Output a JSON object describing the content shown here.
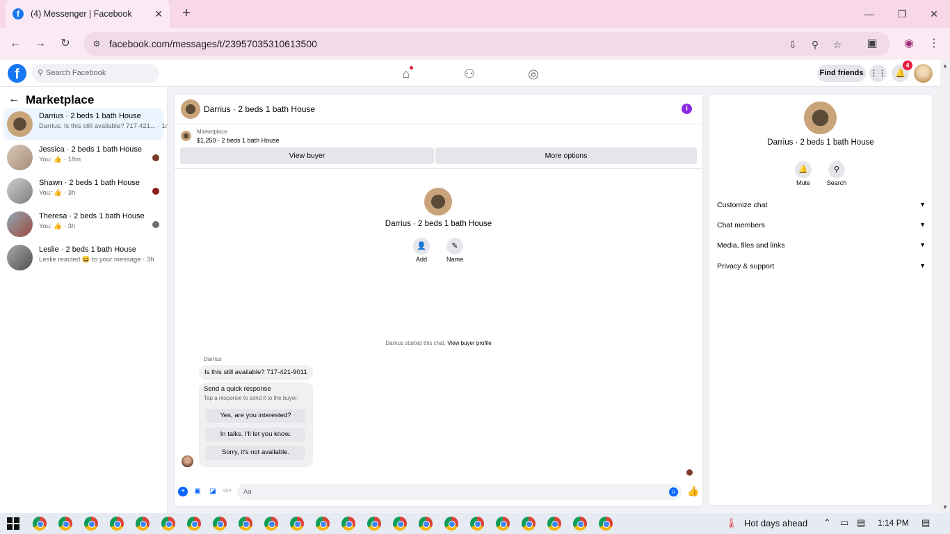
{
  "browser": {
    "tab_title": "(4) Messenger | Facebook",
    "tab_close": "✕",
    "new_tab": "+",
    "url": "facebook.com/messages/t/23957035310613500"
  },
  "fb": {
    "logo": "f",
    "search_placeholder": "Search Facebook",
    "find_friends": "Find friends",
    "notif_count": "4"
  },
  "left": {
    "title": "Marketplace",
    "conversations": [
      {
        "name": "Darrius · 2 beds 1 bath House",
        "preview": "Darrius: Is this still available? 717-421... · 1m",
        "active": true
      },
      {
        "name": "Jessica · 2 beds 1 bath House",
        "preview": "You: 👍 · 18m"
      },
      {
        "name": "Shawn · 2 beds 1 bath House",
        "preview": "You: 👍 · 3h"
      },
      {
        "name": "Theresa · 2 beds 1 bath House",
        "preview": "You: 👍 · 3h"
      },
      {
        "name": "Leslie · 2 beds 1 bath House",
        "preview": "Leslie reacted 😆 to your message · 3h"
      }
    ]
  },
  "chat": {
    "title": "Darrius · 2 beds 1 bath House",
    "info_icon": "i",
    "marketplace_label": "Marketplace",
    "listing": "$1,250 - 2 beds 1 bath House",
    "view_buyer": "View buyer",
    "more_options": "More options",
    "center_name": "Darrius · 2 beds 1 bath House",
    "add_label": "Add",
    "name_label": "Name",
    "started_text": "Darrius started this chat.",
    "view_buyer_profile": "View buyer profile",
    "sender": "Darrius",
    "message": "Is this still available? 717-421-9011",
    "quick_title": "Send a quick response",
    "quick_sub": "Tap a response to send it to the buyer.",
    "quick_responses": [
      "Yes, are you interested?",
      "In talks. I'll let you know.",
      "Sorry, it's not available."
    ],
    "composer_placeholder": "Aa"
  },
  "right": {
    "name": "Darrius · 2 beds 1 bath House",
    "mute": "Mute",
    "search": "Search",
    "sections": [
      "Customize chat",
      "Chat members",
      "Media, files and links",
      "Privacy & support"
    ]
  },
  "taskbar": {
    "weather": "Hot days ahead",
    "time": "1:14 PM"
  },
  "colors": {
    "accent": "#0866ff",
    "tabbar": "#f8d7e8",
    "info": "#8a2be2"
  }
}
